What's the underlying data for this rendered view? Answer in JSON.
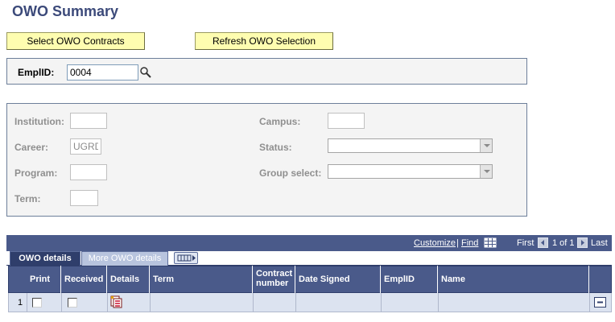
{
  "page": {
    "title": "OWO Summary"
  },
  "toolbar": {
    "select_label": "Select OWO Contracts",
    "refresh_label": "Refresh OWO Selection"
  },
  "emplid_panel": {
    "label": "EmplID:",
    "value": "0004",
    "lookup_icon": "magnifier-icon"
  },
  "details_panel": {
    "institution": {
      "label": "Institution:",
      "value": ""
    },
    "career": {
      "label": "Career:",
      "value": "UGRD"
    },
    "program": {
      "label": "Program:",
      "value": ""
    },
    "term": {
      "label": "Term:",
      "value": ""
    },
    "campus": {
      "label": "Campus:",
      "value": ""
    },
    "status": {
      "label": "Status:",
      "value": ""
    },
    "group_select": {
      "label": "Group select:",
      "value": ""
    }
  },
  "grid": {
    "nav": {
      "customize": "Customize",
      "sep": "|",
      "find": "Find",
      "first": "First",
      "range": "1 of 1",
      "last": "Last"
    },
    "tabs": [
      {
        "label": "OWO details",
        "active": true
      },
      {
        "label": "More OWO details",
        "active": false
      }
    ],
    "columns": [
      "Print",
      "Received",
      "Details",
      "Term",
      "Contract number",
      "Date Signed",
      "EmplID",
      "Name"
    ],
    "rows": [
      {
        "num": "1",
        "print": false,
        "received": false,
        "term": "",
        "contract_number": "",
        "date_signed": "",
        "emplid": "",
        "name": ""
      }
    ]
  },
  "colors": {
    "title": "#3c4a7a",
    "button_bg": "#fefdb0",
    "grid_header": "#4a5a8a",
    "tab_active": "#2f3e6b",
    "row_bg": "#dce3f0"
  }
}
